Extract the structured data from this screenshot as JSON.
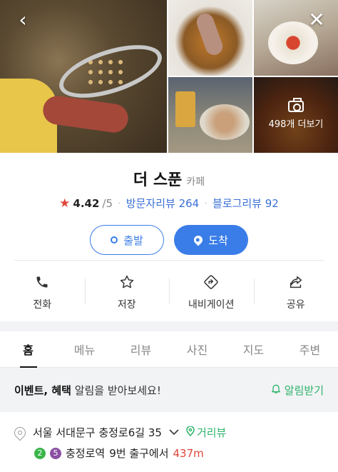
{
  "gallery": {
    "more_label": "498개 더보기"
  },
  "place": {
    "name": "더 스푼",
    "category": "카페",
    "rating": "4.42",
    "rating_max": "/5",
    "visitor_reviews": "방문자리뷰 264",
    "blog_reviews": "블로그리뷰 92"
  },
  "route": {
    "start_label": "출발",
    "dest_label": "도착"
  },
  "actions": [
    {
      "label": "전화",
      "icon": "phone-icon"
    },
    {
      "label": "저장",
      "icon": "star-outline-icon"
    },
    {
      "label": "내비게이션",
      "icon": "navigation-icon"
    },
    {
      "label": "공유",
      "icon": "share-icon"
    }
  ],
  "tabs": [
    {
      "label": "홈"
    },
    {
      "label": "메뉴"
    },
    {
      "label": "리뷰"
    },
    {
      "label": "사진"
    },
    {
      "label": "지도"
    },
    {
      "label": "주변"
    }
  ],
  "alert": {
    "bold": "이벤트, 혜택",
    "rest": " 알림을 받아보세요!",
    "button": "알림받기"
  },
  "address": {
    "text": "서울 서대문구 충정로6길 35",
    "distance_link": "거리뷰",
    "line_a": "2",
    "line_b": "5",
    "station": "충정로역",
    "exit_text": "9번 출구에서",
    "distance": "437m"
  },
  "colors": {
    "accent": "#3a7de8",
    "green": "#2fb36a",
    "red": "#e0453a"
  }
}
